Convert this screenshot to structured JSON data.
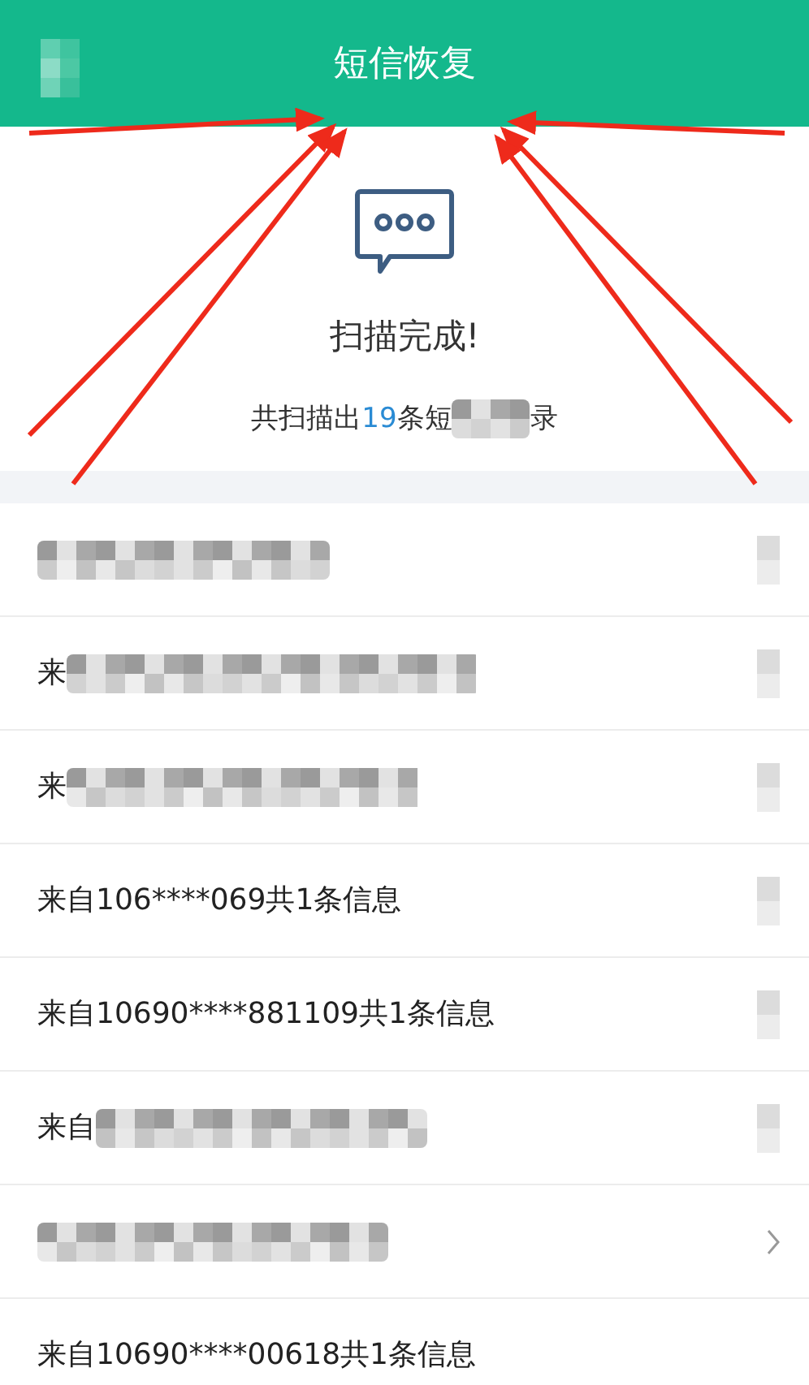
{
  "header": {
    "title": "短信恢复",
    "back_blurred": true
  },
  "scan": {
    "title": "扫描完成!",
    "summary_before": "共扫描出",
    "count": "19",
    "summary_after": "条短",
    "summary_redacted": true,
    "summary_end": "录"
  },
  "rows": [
    {
      "prefix": "",
      "redacted": true,
      "chevron": true,
      "chevron_blurred": true
    },
    {
      "prefix": "来",
      "redacted": true,
      "chevron": true,
      "chevron_blurred": true
    },
    {
      "prefix": "来",
      "redacted": true,
      "chevron": true,
      "chevron_blurred": true
    },
    {
      "prefix": "来自106****069共1条信息",
      "redacted": false,
      "chevron": true,
      "chevron_blurred": true
    },
    {
      "prefix": "来自10690****881109共1条信息",
      "redacted": false,
      "chevron": true,
      "chevron_blurred": true
    },
    {
      "prefix": "来自",
      "redacted": true,
      "chevron": true,
      "chevron_blurred": true
    },
    {
      "prefix": "",
      "redacted": true,
      "chevron": true,
      "chevron_blurred": false
    },
    {
      "prefix": "来自10690****00618共1条信息",
      "redacted": false,
      "chevron": false
    }
  ]
}
